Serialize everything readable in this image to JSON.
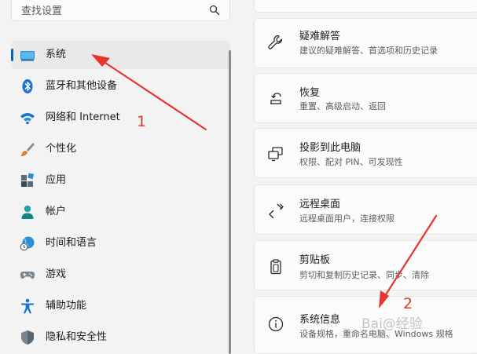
{
  "search": {
    "placeholder": "查找设置"
  },
  "sidebar": {
    "items": [
      {
        "label": "系统",
        "icon": "system-display-icon",
        "active": true
      },
      {
        "label": "蓝牙和其他设备",
        "icon": "bluetooth-icon"
      },
      {
        "label": "网络和 Internet",
        "icon": "wifi-icon"
      },
      {
        "label": "个性化",
        "icon": "brush-icon"
      },
      {
        "label": "应用",
        "icon": "apps-icon"
      },
      {
        "label": "帐户",
        "icon": "account-icon"
      },
      {
        "label": "时间和语言",
        "icon": "globe-clock-icon"
      },
      {
        "label": "游戏",
        "icon": "gamepad-icon"
      },
      {
        "label": "辅助功能",
        "icon": "accessibility-icon"
      },
      {
        "label": "隐私和安全性",
        "icon": "shield-icon"
      }
    ]
  },
  "main": {
    "cards": [
      {
        "title": "疑难解答",
        "subtitle": "建议的疑难解答、首选项和历史记录",
        "icon": "wrench-icon"
      },
      {
        "title": "恢复",
        "subtitle": "重置、高级启动、返回",
        "icon": "recovery-icon"
      },
      {
        "title": "投影到此电脑",
        "subtitle": "权限、配对 PIN、可发现性",
        "icon": "project-icon"
      },
      {
        "title": "远程桌面",
        "subtitle": "远程桌面用户，连接权限",
        "icon": "remote-desktop-icon"
      },
      {
        "title": "剪贴板",
        "subtitle": "剪切和复制历史记录、同步、清除",
        "icon": "clipboard-icon"
      },
      {
        "title": "系统信息",
        "subtitle": "设备规格，重命名电脑、Windows 规格",
        "icon": "info-icon"
      }
    ]
  },
  "annotations": {
    "marker1": "1",
    "marker2": "2",
    "color": "#e8352c"
  },
  "watermark": {
    "text": "Bai@经验"
  },
  "colors": {
    "accent": "#0067c0",
    "background": "#f3f3f3",
    "card": "#fbfbfb"
  }
}
